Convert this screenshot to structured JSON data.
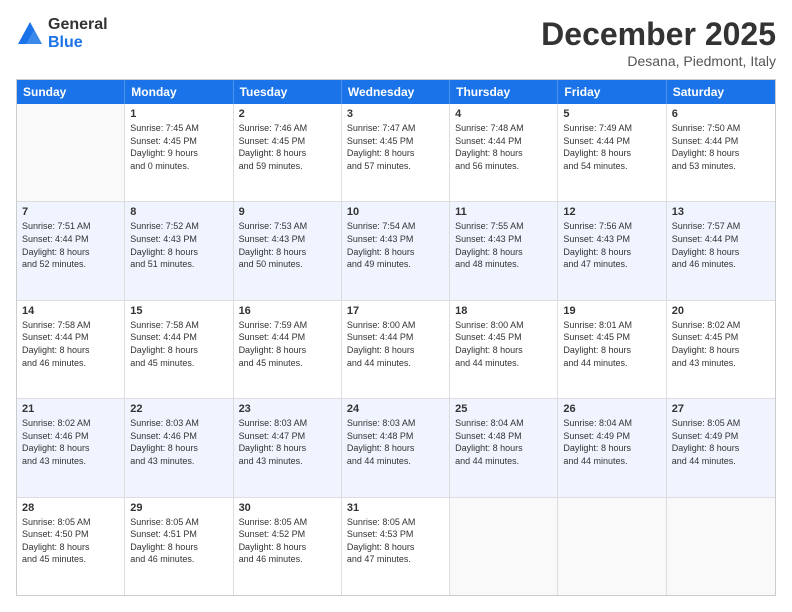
{
  "logo": {
    "general": "General",
    "blue": "Blue"
  },
  "header": {
    "month": "December 2025",
    "location": "Desana, Piedmont, Italy"
  },
  "days": [
    "Sunday",
    "Monday",
    "Tuesday",
    "Wednesday",
    "Thursday",
    "Friday",
    "Saturday"
  ],
  "weeks": [
    [
      {
        "num": "",
        "lines": []
      },
      {
        "num": "1",
        "lines": [
          "Sunrise: 7:45 AM",
          "Sunset: 4:45 PM",
          "Daylight: 9 hours",
          "and 0 minutes."
        ]
      },
      {
        "num": "2",
        "lines": [
          "Sunrise: 7:46 AM",
          "Sunset: 4:45 PM",
          "Daylight: 8 hours",
          "and 59 minutes."
        ]
      },
      {
        "num": "3",
        "lines": [
          "Sunrise: 7:47 AM",
          "Sunset: 4:45 PM",
          "Daylight: 8 hours",
          "and 57 minutes."
        ]
      },
      {
        "num": "4",
        "lines": [
          "Sunrise: 7:48 AM",
          "Sunset: 4:44 PM",
          "Daylight: 8 hours",
          "and 56 minutes."
        ]
      },
      {
        "num": "5",
        "lines": [
          "Sunrise: 7:49 AM",
          "Sunset: 4:44 PM",
          "Daylight: 8 hours",
          "and 54 minutes."
        ]
      },
      {
        "num": "6",
        "lines": [
          "Sunrise: 7:50 AM",
          "Sunset: 4:44 PM",
          "Daylight: 8 hours",
          "and 53 minutes."
        ]
      }
    ],
    [
      {
        "num": "7",
        "lines": [
          "Sunrise: 7:51 AM",
          "Sunset: 4:44 PM",
          "Daylight: 8 hours",
          "and 52 minutes."
        ]
      },
      {
        "num": "8",
        "lines": [
          "Sunrise: 7:52 AM",
          "Sunset: 4:43 PM",
          "Daylight: 8 hours",
          "and 51 minutes."
        ]
      },
      {
        "num": "9",
        "lines": [
          "Sunrise: 7:53 AM",
          "Sunset: 4:43 PM",
          "Daylight: 8 hours",
          "and 50 minutes."
        ]
      },
      {
        "num": "10",
        "lines": [
          "Sunrise: 7:54 AM",
          "Sunset: 4:43 PM",
          "Daylight: 8 hours",
          "and 49 minutes."
        ]
      },
      {
        "num": "11",
        "lines": [
          "Sunrise: 7:55 AM",
          "Sunset: 4:43 PM",
          "Daylight: 8 hours",
          "and 48 minutes."
        ]
      },
      {
        "num": "12",
        "lines": [
          "Sunrise: 7:56 AM",
          "Sunset: 4:43 PM",
          "Daylight: 8 hours",
          "and 47 minutes."
        ]
      },
      {
        "num": "13",
        "lines": [
          "Sunrise: 7:57 AM",
          "Sunset: 4:44 PM",
          "Daylight: 8 hours",
          "and 46 minutes."
        ]
      }
    ],
    [
      {
        "num": "14",
        "lines": [
          "Sunrise: 7:58 AM",
          "Sunset: 4:44 PM",
          "Daylight: 8 hours",
          "and 46 minutes."
        ]
      },
      {
        "num": "15",
        "lines": [
          "Sunrise: 7:58 AM",
          "Sunset: 4:44 PM",
          "Daylight: 8 hours",
          "and 45 minutes."
        ]
      },
      {
        "num": "16",
        "lines": [
          "Sunrise: 7:59 AM",
          "Sunset: 4:44 PM",
          "Daylight: 8 hours",
          "and 45 minutes."
        ]
      },
      {
        "num": "17",
        "lines": [
          "Sunrise: 8:00 AM",
          "Sunset: 4:44 PM",
          "Daylight: 8 hours",
          "and 44 minutes."
        ]
      },
      {
        "num": "18",
        "lines": [
          "Sunrise: 8:00 AM",
          "Sunset: 4:45 PM",
          "Daylight: 8 hours",
          "and 44 minutes."
        ]
      },
      {
        "num": "19",
        "lines": [
          "Sunrise: 8:01 AM",
          "Sunset: 4:45 PM",
          "Daylight: 8 hours",
          "and 44 minutes."
        ]
      },
      {
        "num": "20",
        "lines": [
          "Sunrise: 8:02 AM",
          "Sunset: 4:45 PM",
          "Daylight: 8 hours",
          "and 43 minutes."
        ]
      }
    ],
    [
      {
        "num": "21",
        "lines": [
          "Sunrise: 8:02 AM",
          "Sunset: 4:46 PM",
          "Daylight: 8 hours",
          "and 43 minutes."
        ]
      },
      {
        "num": "22",
        "lines": [
          "Sunrise: 8:03 AM",
          "Sunset: 4:46 PM",
          "Daylight: 8 hours",
          "and 43 minutes."
        ]
      },
      {
        "num": "23",
        "lines": [
          "Sunrise: 8:03 AM",
          "Sunset: 4:47 PM",
          "Daylight: 8 hours",
          "and 43 minutes."
        ]
      },
      {
        "num": "24",
        "lines": [
          "Sunrise: 8:03 AM",
          "Sunset: 4:48 PM",
          "Daylight: 8 hours",
          "and 44 minutes."
        ]
      },
      {
        "num": "25",
        "lines": [
          "Sunrise: 8:04 AM",
          "Sunset: 4:48 PM",
          "Daylight: 8 hours",
          "and 44 minutes."
        ]
      },
      {
        "num": "26",
        "lines": [
          "Sunrise: 8:04 AM",
          "Sunset: 4:49 PM",
          "Daylight: 8 hours",
          "and 44 minutes."
        ]
      },
      {
        "num": "27",
        "lines": [
          "Sunrise: 8:05 AM",
          "Sunset: 4:49 PM",
          "Daylight: 8 hours",
          "and 44 minutes."
        ]
      }
    ],
    [
      {
        "num": "28",
        "lines": [
          "Sunrise: 8:05 AM",
          "Sunset: 4:50 PM",
          "Daylight: 8 hours",
          "and 45 minutes."
        ]
      },
      {
        "num": "29",
        "lines": [
          "Sunrise: 8:05 AM",
          "Sunset: 4:51 PM",
          "Daylight: 8 hours",
          "and 46 minutes."
        ]
      },
      {
        "num": "30",
        "lines": [
          "Sunrise: 8:05 AM",
          "Sunset: 4:52 PM",
          "Daylight: 8 hours",
          "and 46 minutes."
        ]
      },
      {
        "num": "31",
        "lines": [
          "Sunrise: 8:05 AM",
          "Sunset: 4:53 PM",
          "Daylight: 8 hours",
          "and 47 minutes."
        ]
      },
      {
        "num": "",
        "lines": []
      },
      {
        "num": "",
        "lines": []
      },
      {
        "num": "",
        "lines": []
      }
    ]
  ]
}
